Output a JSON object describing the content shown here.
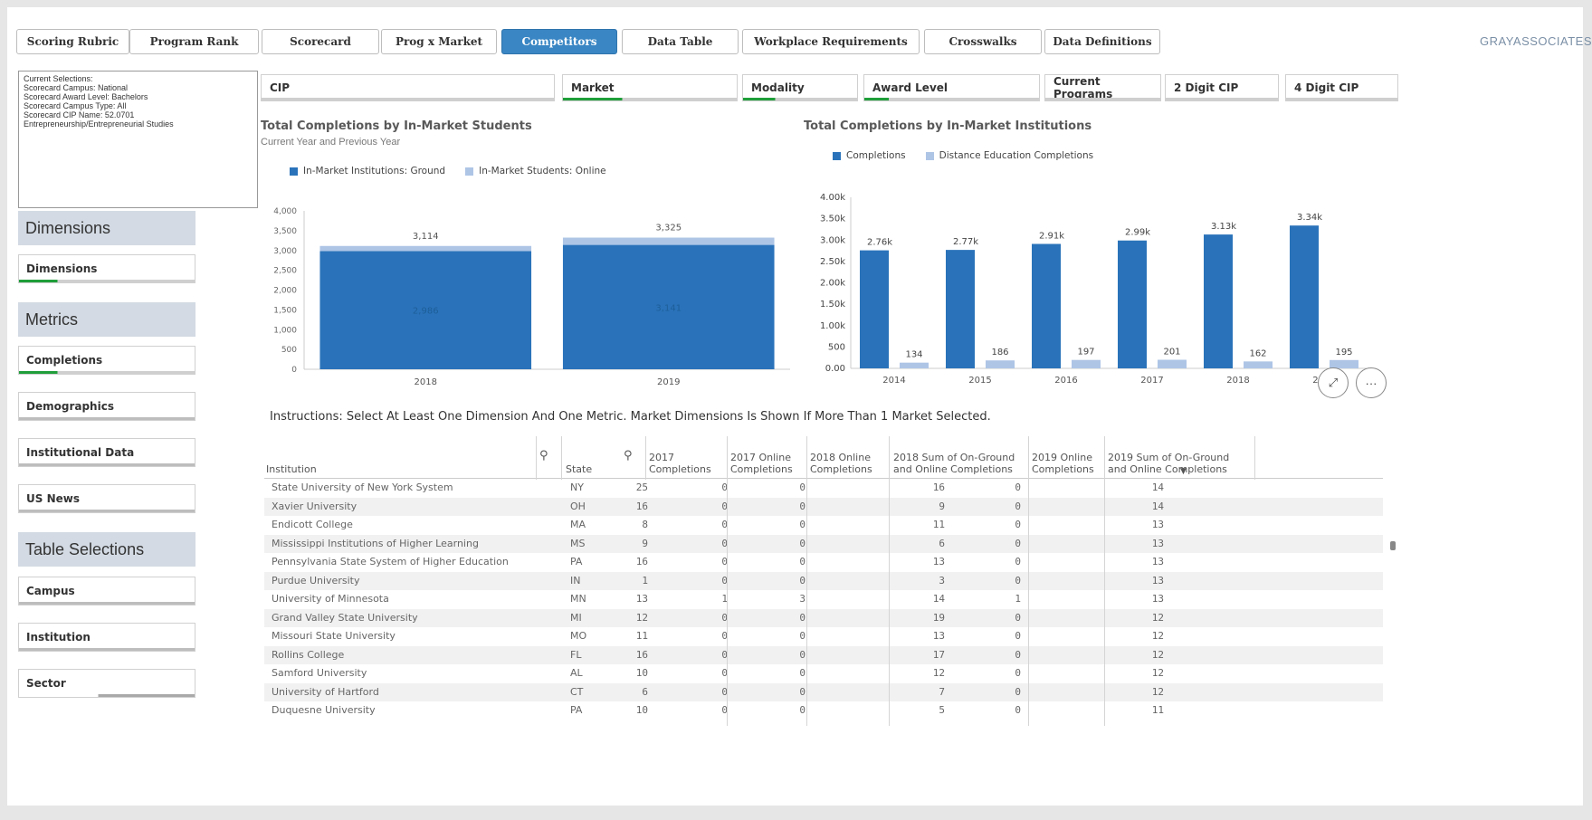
{
  "nav": {
    "tabs": [
      {
        "label": "Scoring Rubric"
      },
      {
        "label": "Program Rank"
      },
      {
        "label": "Scorecard"
      },
      {
        "label": "Prog x Market"
      },
      {
        "label": "Competitors",
        "active": true
      },
      {
        "label": "Data Table"
      },
      {
        "label": "Workplace Requirements"
      },
      {
        "label": "Crosswalks"
      },
      {
        "label": "Data Definitions"
      }
    ],
    "brand": "GRAYASSOCIATES"
  },
  "selections": {
    "lines": [
      "Current Selections:",
      "Scorecard Campus: National",
      "Scorecard Award Level: Bachelors",
      "Scorecard Campus Type: All",
      "Scorecard CIP Name: 52.0701",
      "Entrepreneurship/Entrepreneurial Studies"
    ]
  },
  "sidebar": {
    "dimensions_header": "Dimensions",
    "dimensions_btn": "Dimensions",
    "metrics_header": "Metrics",
    "completions_btn": "Completions",
    "demographics_btn": "Demographics",
    "institutional_btn": "Institutional Data",
    "usnews_btn": "US News",
    "table_header": "Table Selections",
    "campus_btn": "Campus",
    "institution_btn": "Institution",
    "sector_btn": "Sector"
  },
  "filters": {
    "cip": "CIP",
    "market": "Market",
    "modality": "Modality",
    "award": "Award Level",
    "current_programs": "Current Programs",
    "cip2": "2 Digit CIP",
    "cip4": "4 Digit CIP"
  },
  "chart_data": [
    {
      "type": "bar",
      "title": "Total Completions by In-Market Students",
      "subtitle": "Current Year and Previous Year",
      "categories": [
        "2018",
        "2019"
      ],
      "series": [
        {
          "name": "In-Market Institutions: Ground",
          "values": [
            2986,
            3141
          ],
          "color": "#2a73ba"
        },
        {
          "name": "In-Market Students: Online",
          "values": [
            128,
            184
          ],
          "color": "#aec5e6"
        }
      ],
      "totals": [
        3114,
        3325
      ],
      "total_labels": [
        "3,114",
        "3,325"
      ],
      "inner_labels": [
        "2,986",
        "3,141"
      ],
      "yticks": [
        "0",
        "500",
        "1,000",
        "1,500",
        "2,000",
        "2,500",
        "3,000",
        "3,500",
        "4,000"
      ],
      "ylim": [
        0,
        4000
      ],
      "stacked": true
    },
    {
      "type": "bar",
      "title": "Total Completions by In-Market Institutions",
      "categories": [
        "2014",
        "2015",
        "2016",
        "2017",
        "2018",
        "2019"
      ],
      "series": [
        {
          "name": "Completions",
          "values": [
            2760,
            2770,
            2910,
            2990,
            3130,
            3340
          ],
          "labels": [
            "2.76k",
            "2.77k",
            "2.91k",
            "2.99k",
            "3.13k",
            "3.34k"
          ],
          "color": "#2a73ba"
        },
        {
          "name": "Distance Education Completions",
          "values": [
            134,
            186,
            197,
            201,
            162,
            195
          ],
          "labels": [
            "134",
            "186",
            "197",
            "201",
            "162",
            "195"
          ],
          "color": "#aec5e6"
        }
      ],
      "yticks": [
        "0.00",
        "500",
        "1.00k",
        "1.50k",
        "2.00k",
        "2.50k",
        "3.00k",
        "3.50k",
        "4.00k"
      ],
      "ylim": [
        0,
        4000
      ]
    }
  ],
  "instructions": "Instructions: Select At Least One Dimension And One Metric. Market Dimensions Is Shown If More Than 1 Market Selected.",
  "table": {
    "headers": {
      "institution": "Institution",
      "state": "State",
      "c2017": [
        "2017",
        "Completions"
      ],
      "o2017": [
        "2017 Online",
        "Completions"
      ],
      "o2018": [
        "2018 Online",
        "Completions"
      ],
      "s2018": [
        "2018 Sum of On-Ground",
        "and Online Completions"
      ],
      "o2019": [
        "2019 Online",
        "Completions"
      ],
      "s2019": [
        "2019 Sum of On-Ground",
        "and Online Completions"
      ]
    },
    "rows": [
      [
        "State University of New York System",
        "NY",
        "25",
        "0",
        "0",
        "16",
        "0",
        "14"
      ],
      [
        "Xavier University",
        "OH",
        "16",
        "0",
        "0",
        "9",
        "0",
        "14"
      ],
      [
        "Endicott College",
        "MA",
        "8",
        "0",
        "0",
        "11",
        "0",
        "13"
      ],
      [
        "Mississippi Institutions of Higher Learning",
        "MS",
        "9",
        "0",
        "0",
        "6",
        "0",
        "13"
      ],
      [
        "Pennsylvania State System of Higher Education",
        "PA",
        "16",
        "0",
        "0",
        "13",
        "0",
        "13"
      ],
      [
        "Purdue University",
        "IN",
        "1",
        "0",
        "0",
        "3",
        "0",
        "13"
      ],
      [
        "University of Minnesota",
        "MN",
        "13",
        "1",
        "3",
        "14",
        "1",
        "13"
      ],
      [
        "Grand Valley State University",
        "MI",
        "12",
        "0",
        "0",
        "19",
        "0",
        "12"
      ],
      [
        "Missouri State University",
        "MO",
        "11",
        "0",
        "0",
        "13",
        "0",
        "12"
      ],
      [
        "Rollins College",
        "FL",
        "16",
        "0",
        "0",
        "17",
        "0",
        "12"
      ],
      [
        "Samford University",
        "AL",
        "10",
        "0",
        "0",
        "12",
        "0",
        "12"
      ],
      [
        "University of Hartford",
        "CT",
        "6",
        "0",
        "0",
        "7",
        "0",
        "12"
      ],
      [
        "Duquesne University",
        "PA",
        "10",
        "0",
        "0",
        "5",
        "0",
        "11"
      ]
    ]
  }
}
